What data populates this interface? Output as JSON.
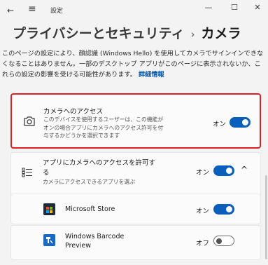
{
  "window": {
    "app_title": "設定",
    "back_icon": "←",
    "menu_icon": "≡",
    "minimize_icon": "—",
    "maximize_icon": "☐",
    "close_icon": "✕"
  },
  "breadcrumb": {
    "parent": "プライバシーとセキュリティ",
    "separator": "›",
    "current": "カメラ"
  },
  "description": {
    "text": "このページの設定により、顔認識 (Windows Hello) を使用してカメラでサインインできなくなることはありません。一部のデスクトップ アプリがこのページに表示されないか、これらの設定の影響を受ける可能性があります。",
    "link": "詳細情報"
  },
  "camera_access": {
    "title": "カメラへのアクセス",
    "subtitle_lines": [
      "このデバイスを使用するユーザーは、この機能が",
      "オンの場合アプリにカメラへのアクセス許可を付",
      "与するかどうかを選択できます"
    ],
    "state_label": "オン",
    "enabled": true
  },
  "app_access": {
    "title_lines": [
      "アプリにカメラへのアクセスを許可す",
      "る"
    ],
    "subtitle": "カメラにアクセスできるアプリを選ぶ",
    "state_label": "オン",
    "enabled": true,
    "expand_icon": "^"
  },
  "apps": [
    {
      "name": "Microsoft Store",
      "state_label": "オン",
      "enabled": true
    },
    {
      "name_lines": [
        "Windows Barcode",
        "Preview"
      ],
      "state_label": "オフ",
      "enabled": false
    }
  ],
  "colors": {
    "accent": "#0a5fbd",
    "highlight_border": "#e01f26",
    "link": "#0b5cad"
  }
}
